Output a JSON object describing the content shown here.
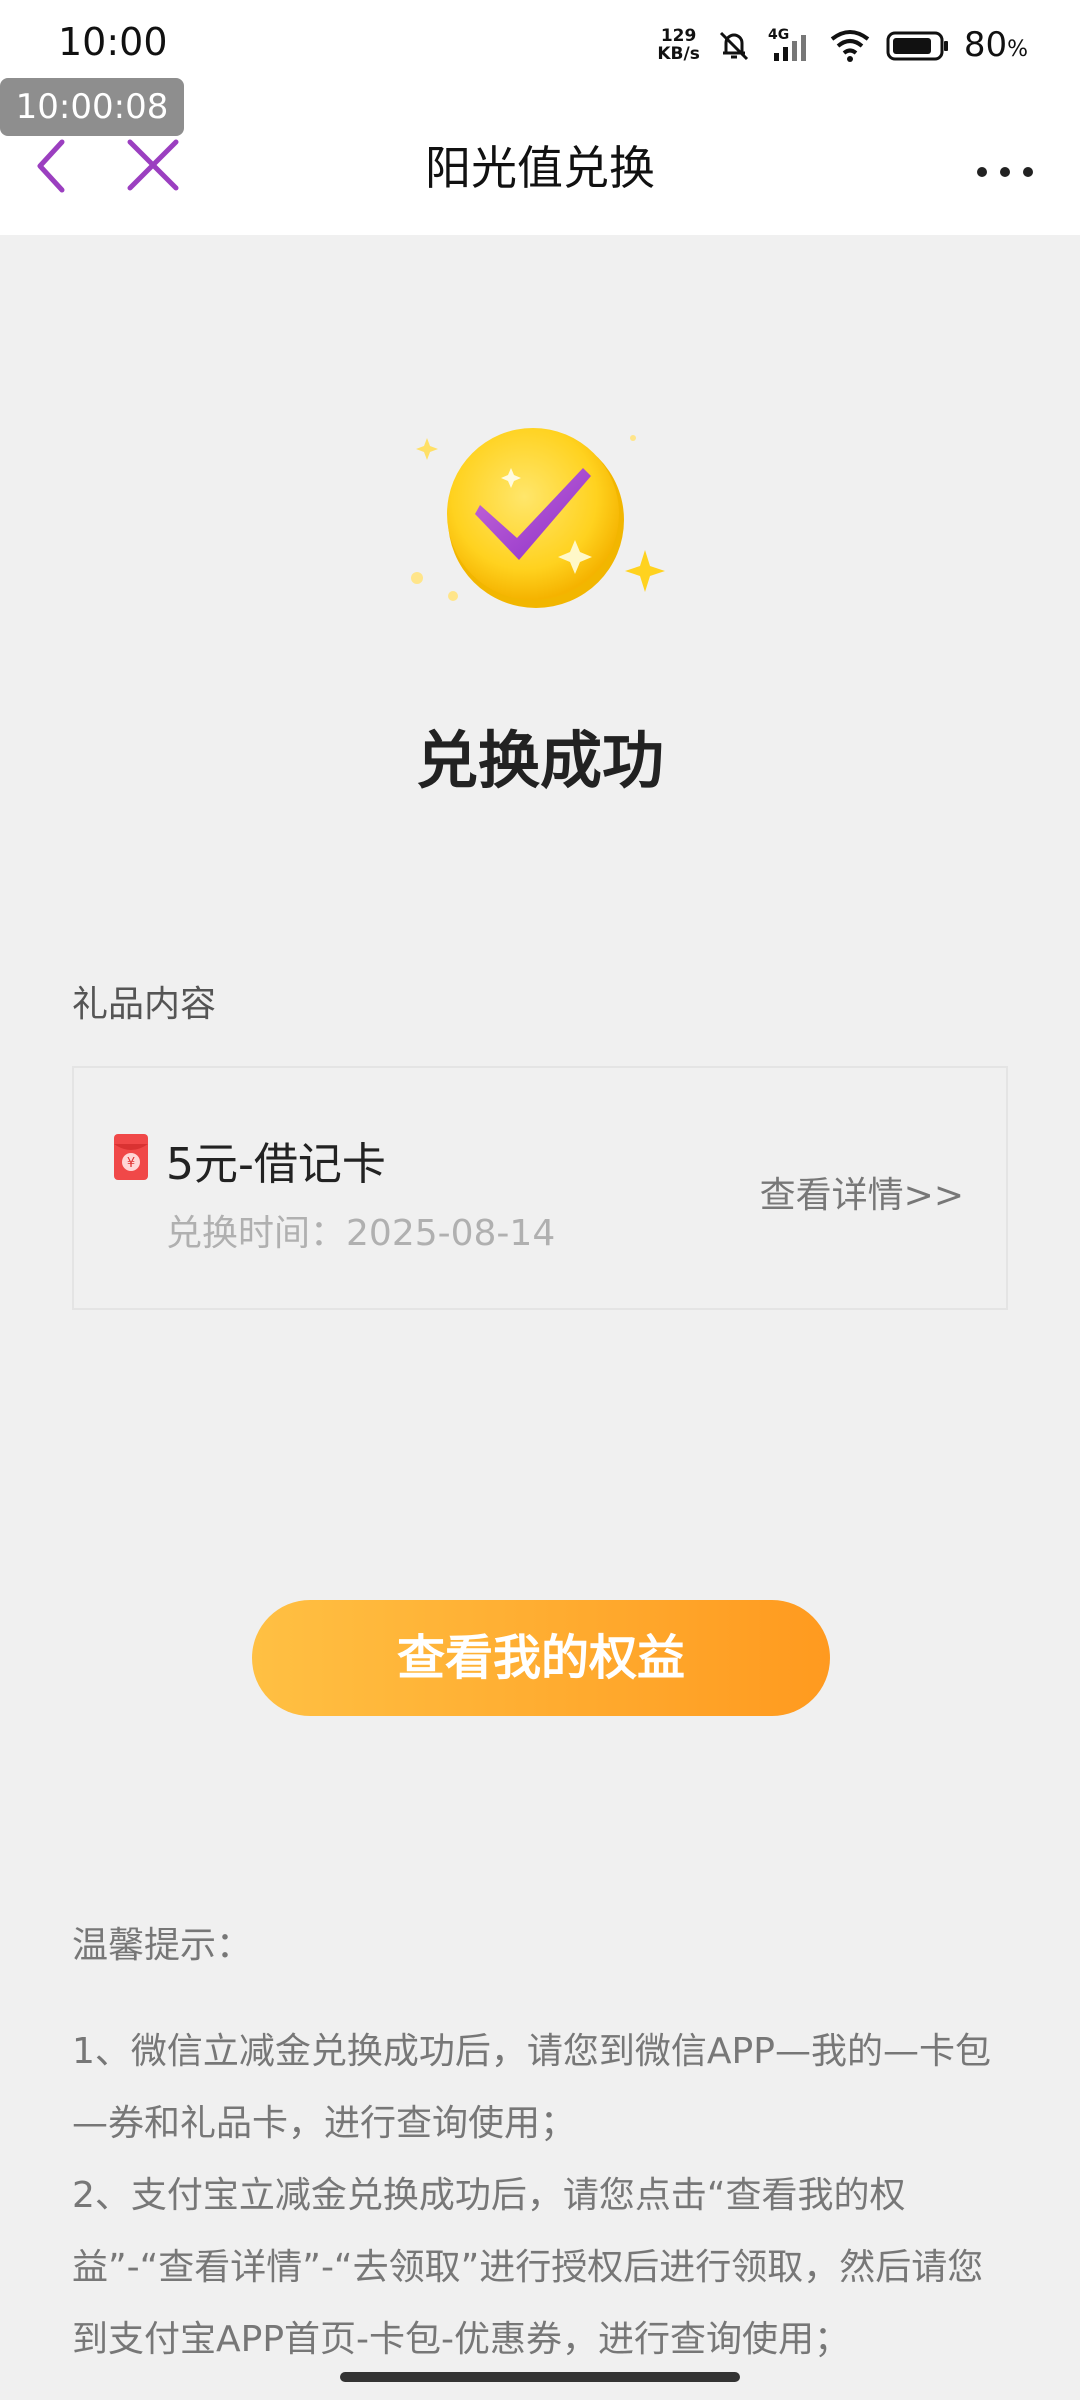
{
  "status_bar": {
    "time": "10:00",
    "net_speed_value": "129",
    "net_speed_unit": "KB/s",
    "network_type": "4G",
    "battery_percent": "80",
    "battery_unit": "%"
  },
  "overlay": {
    "timestamp": "10:00:08"
  },
  "nav": {
    "title": "阳光值兑换",
    "back_icon": "chevron-left-icon",
    "close_icon": "close-icon",
    "more_icon": "more-horizontal-icon"
  },
  "success": {
    "title": "兑换成功",
    "icon": "success-coin-check-icon"
  },
  "gift": {
    "section_label": "礼品内容",
    "name": "5元-借记卡",
    "time_label": "兑换时间：",
    "time_value": "2025-08-14",
    "detail_link": "查看详情>>",
    "icon": "red-envelope-icon"
  },
  "action": {
    "button_label": "查看我的权益"
  },
  "tips": {
    "title": "温馨提示：",
    "items": [
      "1、微信立减金兑换成功后，请您到微信APP—我的—卡包—券和礼品卡，进行查询使用；",
      "2、支付宝立减金兑换成功后，请您点击“查看我的权益”-“查看详情”-“去领取”进行授权后进行领取，然后请您到支付宝APP首页-卡包-优惠券，进行查询使用；"
    ]
  },
  "colors": {
    "accent_purple": "#9b3fc0",
    "button_start": "#ffc043",
    "button_end": "#ff9a1f",
    "page_bg": "#f0f0f0"
  }
}
